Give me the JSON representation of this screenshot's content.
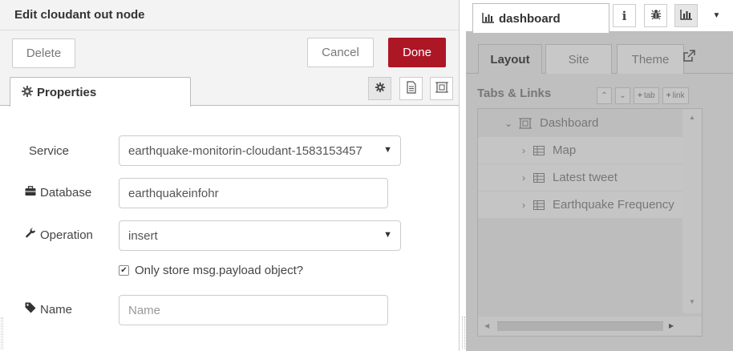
{
  "tray": {
    "title": "Edit cloudant out node",
    "delete_label": "Delete",
    "cancel_label": "Cancel",
    "done_label": "Done",
    "tab_label": "Properties"
  },
  "form": {
    "service_label": "Service",
    "service_value": "earthquake-monitorin-cloudant-1583153457",
    "database_label": "Database",
    "database_value": "earthquakeinfohr",
    "operation_label": "Operation",
    "operation_value": "insert",
    "checkbox_label": "Only store msg.payload object?",
    "checkbox_checked": true,
    "name_label": "Name",
    "name_placeholder": "Name",
    "name_value": ""
  },
  "sidebar": {
    "tab_label": "dashboard",
    "dash_tabs": [
      "Layout",
      "Site",
      "Theme"
    ],
    "section_title": "Tabs & Links",
    "mini_buttons": [
      "tab",
      "link"
    ],
    "tree": {
      "root": "Dashboard",
      "items": [
        "Map",
        "Latest tweet",
        "Earthquake Frequency"
      ]
    }
  },
  "colors": {
    "done_button": "#ad1625",
    "sidebar_bg": "#bfbfbf"
  }
}
